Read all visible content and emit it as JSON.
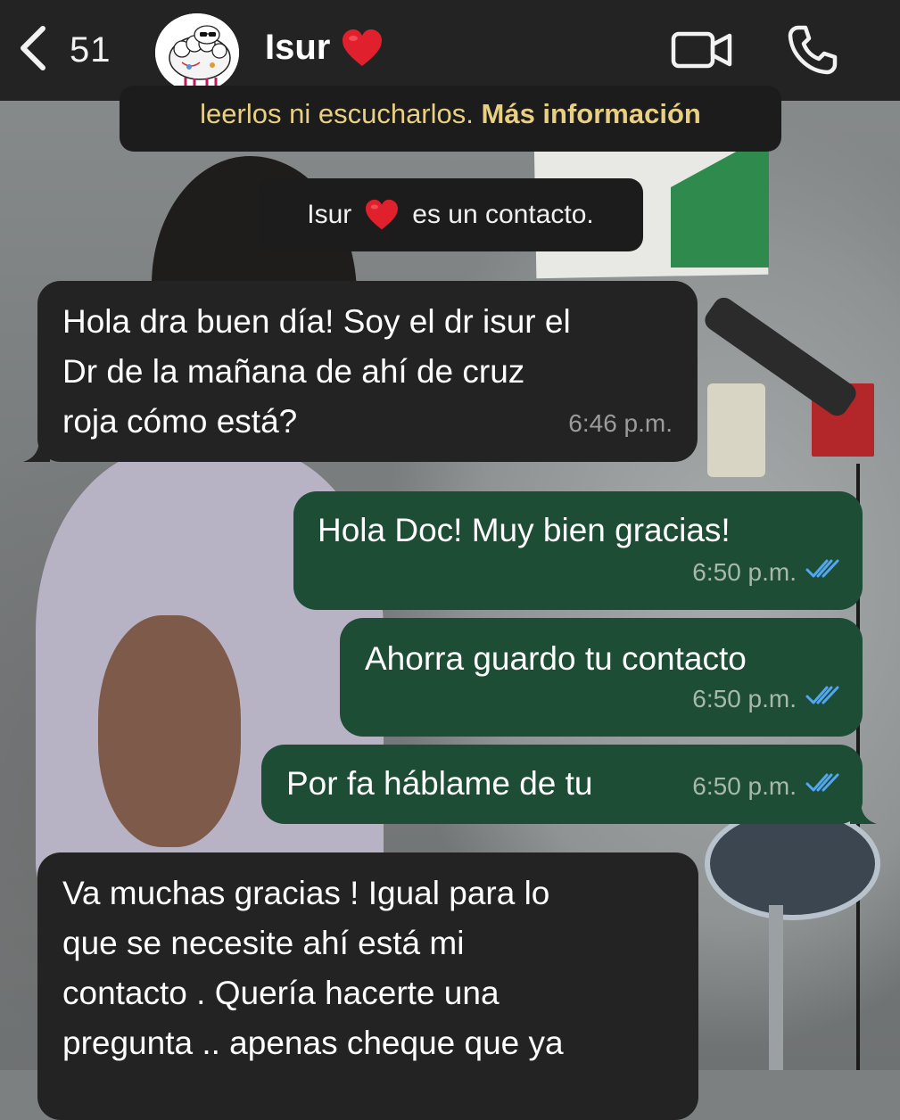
{
  "header": {
    "unread_count": "51",
    "contact_name": "Isur",
    "icons": {
      "back": "chevron-left-icon",
      "video": "video-camera-icon",
      "call": "phone-icon",
      "heart": "red-heart-emoji"
    }
  },
  "system": {
    "encryption_text": "leerlos ni escucharlos.",
    "encryption_link": "Más información",
    "contact_name": "Isur",
    "contact_notice": "es un contacto."
  },
  "messages": [
    {
      "direction": "incoming",
      "text": "Hola dra buen día! Soy el dr isur el\nDr de la mañana de ahí de cruz\nroja cómo está?",
      "time": "6:46 p.m."
    },
    {
      "direction": "outgoing",
      "text": "Hola Doc! Muy bien gracias!",
      "time": "6:50 p.m.",
      "status": "read"
    },
    {
      "direction": "outgoing",
      "text": "Ahorra guardo tu contacto",
      "time": "6:50 p.m.",
      "status": "read"
    },
    {
      "direction": "outgoing",
      "text": "Por fa háblame de tu",
      "time": "6:50 p.m.",
      "status": "read"
    },
    {
      "direction": "incoming",
      "text": "Va muchas gracias ! Igual para lo\nque se necesite ahí está mi\ncontacto . Quería hacerte una\npregunta .. apenas cheque que ya",
      "time": ""
    }
  ],
  "colors": {
    "header_bg": "#232323",
    "incoming_bubble": "#232323",
    "outgoing_bubble": "#1d4d35",
    "link_yellow": "#e8cf82",
    "read_ticks": "#53a6f0",
    "heart_red": "#e0202c"
  }
}
